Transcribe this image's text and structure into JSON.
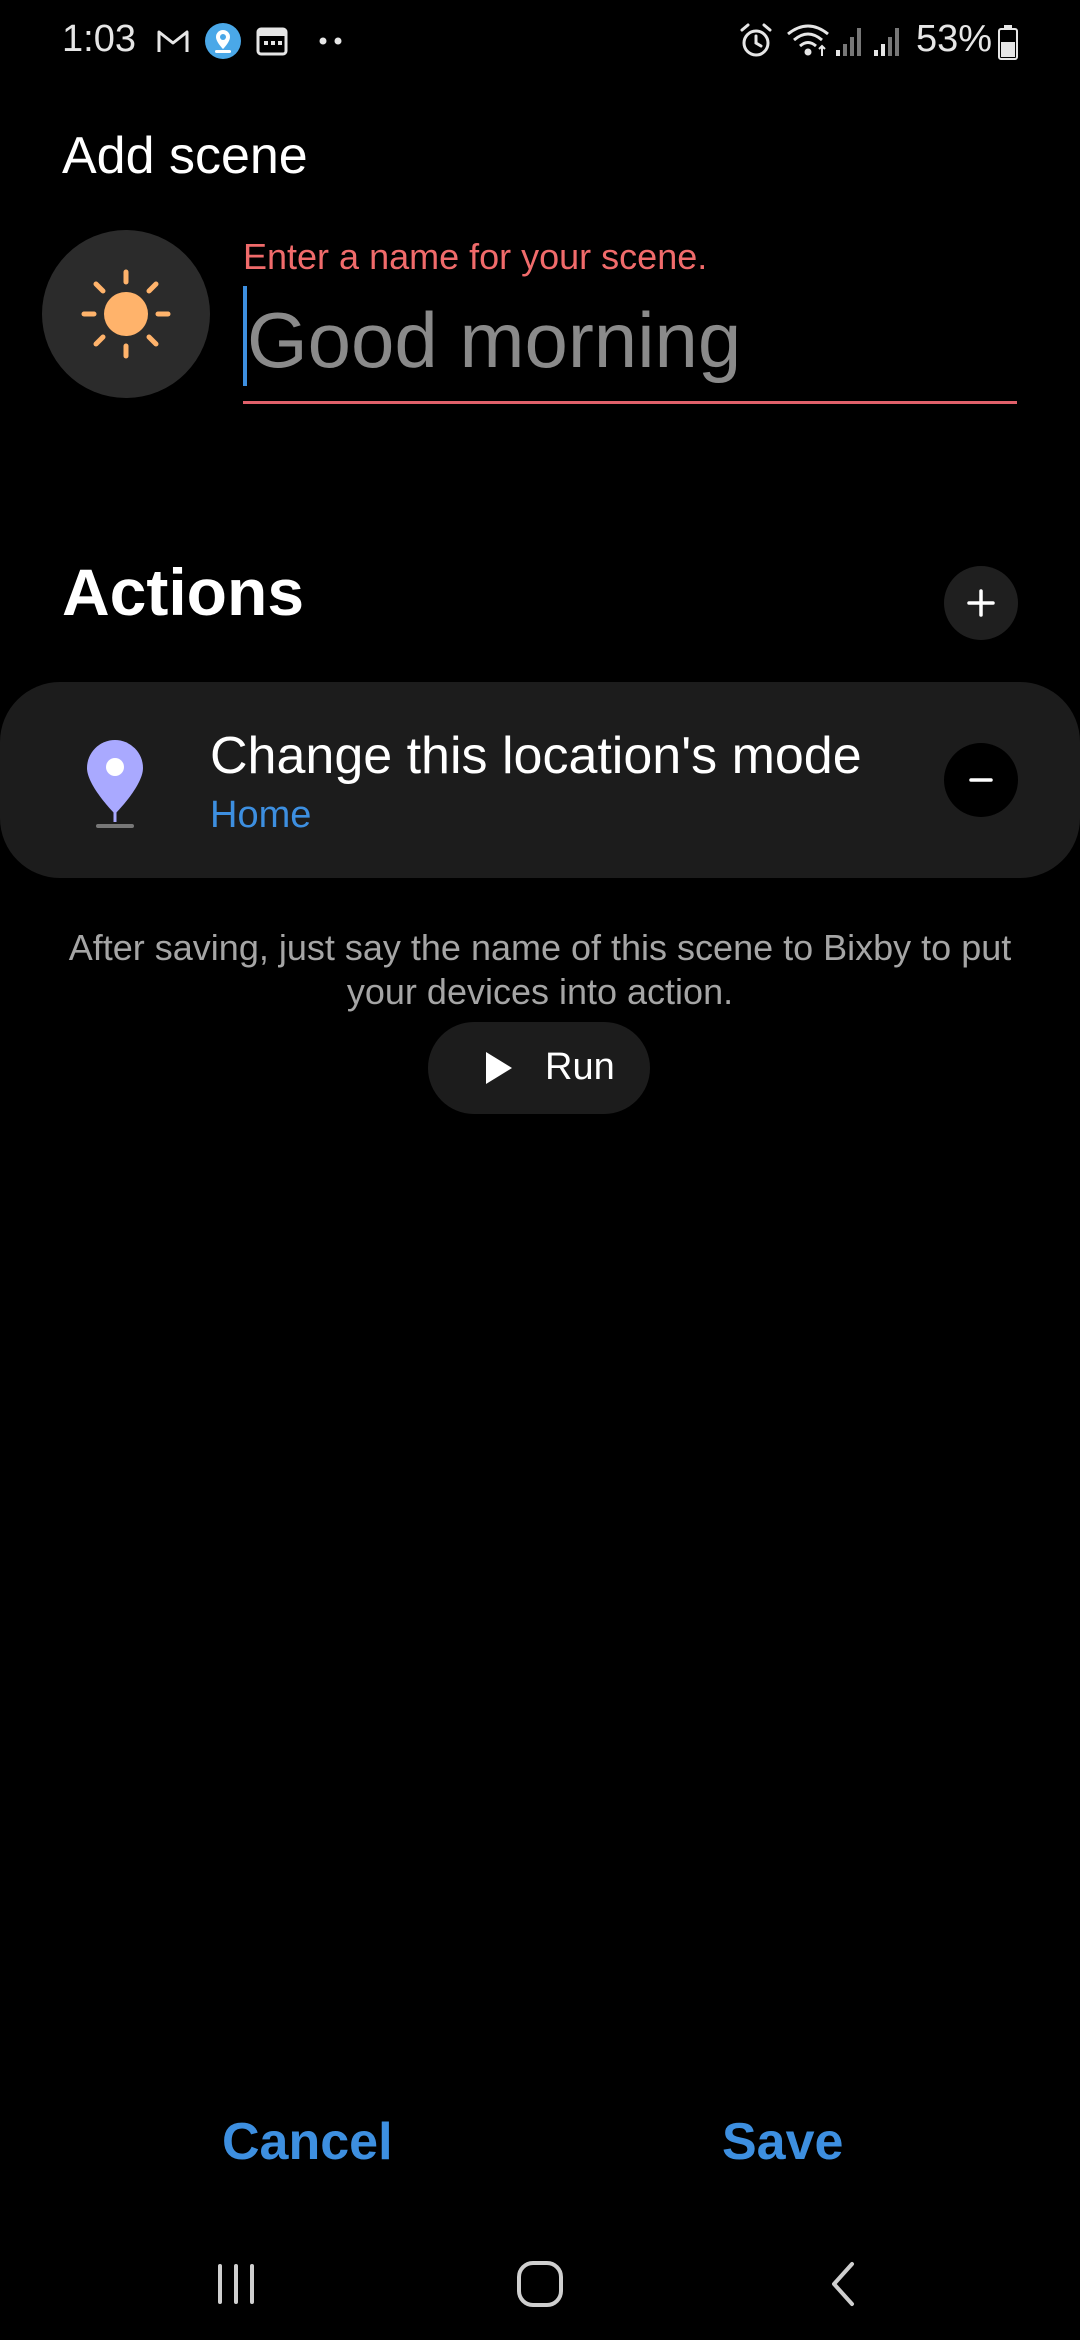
{
  "status_bar": {
    "time": "1:03",
    "battery": "53%",
    "icons": [
      "gmail-icon",
      "maps-location-icon",
      "calendar-icon",
      "more-dots-icon",
      "alarm-icon",
      "wifi-icon",
      "signal-icon",
      "signal-icon-2",
      "battery-icon"
    ]
  },
  "header": {
    "title": "Add scene"
  },
  "scene_name": {
    "hint": "Enter a name for your scene.",
    "placeholder": "Good morning",
    "value": "",
    "icon": "sun-icon"
  },
  "actions": {
    "title": "Actions",
    "add_icon": "plus-icon",
    "items": [
      {
        "title": "Change this location's mode",
        "subtitle": "Home",
        "icon": "location-pin-icon",
        "remove_icon": "minus-icon"
      }
    ]
  },
  "info": {
    "text": "After saving, just say the name of this scene to Bixby to put your devices into action."
  },
  "run_button": {
    "label": "Run",
    "icon": "play-icon"
  },
  "footer": {
    "cancel_label": "Cancel",
    "save_label": "Save"
  },
  "nav_bar": {
    "icons": [
      "recent-apps-icon",
      "home-icon",
      "back-icon"
    ]
  },
  "colors": {
    "background": "#000000",
    "accent": "#3d8fe0",
    "error": "#f06b6b",
    "card": "#1c1c1c",
    "sun": "#ffb36b",
    "pin": "#a9a9ff"
  }
}
